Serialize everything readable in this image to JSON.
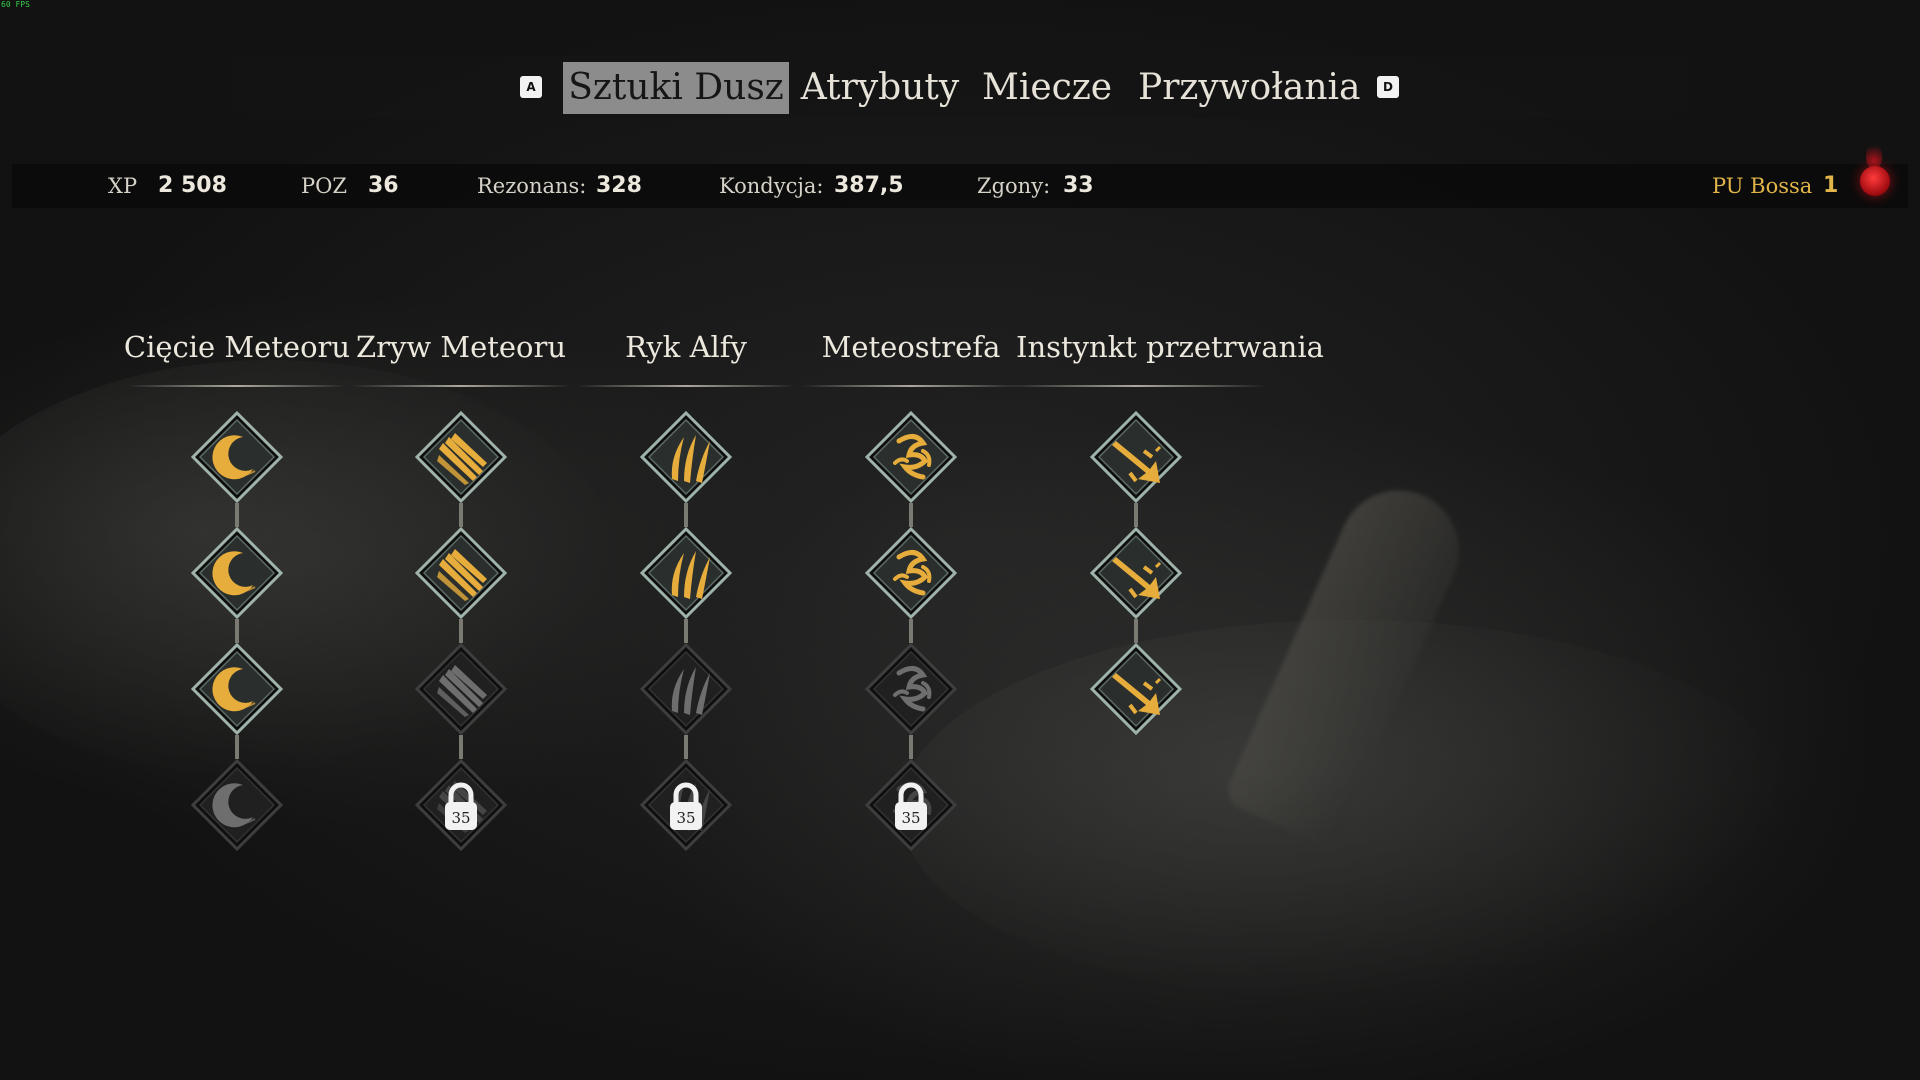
{
  "fps": "60 FPS",
  "tabs": {
    "prev_key": "A",
    "next_key": "D",
    "items": [
      {
        "label": "Sztuki Dusz",
        "active": true
      },
      {
        "label": "Atrybuty",
        "active": false
      },
      {
        "label": "Miecze",
        "active": false
      },
      {
        "label": "Przywołania",
        "active": false
      }
    ]
  },
  "stats": {
    "xp_label": "XP",
    "xp_value": "2 508",
    "level_label": "POZ",
    "level_value": "36",
    "resonance_label": "Rezonans:",
    "resonance_value": "328",
    "condition_label": "Kondycja:",
    "condition_value": "387,5",
    "deaths_label": "Zgony:",
    "deaths_value": "33",
    "boss_label": "PU Bossa",
    "boss_value": "1"
  },
  "colors": {
    "gold": "#e2b54a",
    "node_gold": "#e6ad3c",
    "node_dim": "#6e6e6e",
    "frame_teal": "#9fb3ab"
  },
  "columns": [
    {
      "title": "Cięcie Meteoru",
      "icon": "crescent-moon-icon",
      "nodes": [
        {
          "state": "unlocked"
        },
        {
          "state": "unlocked"
        },
        {
          "state": "unlocked"
        },
        {
          "state": "available"
        }
      ]
    },
    {
      "title": "Zryw Meteoru",
      "icon": "claw-slash-icon",
      "nodes": [
        {
          "state": "unlocked"
        },
        {
          "state": "unlocked"
        },
        {
          "state": "available"
        },
        {
          "state": "locked",
          "level": "35"
        }
      ]
    },
    {
      "title": "Ryk Alfy",
      "icon": "triple-claw-icon",
      "nodes": [
        {
          "state": "unlocked"
        },
        {
          "state": "unlocked"
        },
        {
          "state": "available"
        },
        {
          "state": "locked",
          "level": "35"
        }
      ]
    },
    {
      "title": "Meteostrefa",
      "icon": "rune-glyph-icon",
      "nodes": [
        {
          "state": "unlocked"
        },
        {
          "state": "unlocked"
        },
        {
          "state": "available"
        },
        {
          "state": "locked",
          "level": "35"
        }
      ]
    },
    {
      "title": "Instynkt przetrwania",
      "icon": "impact-strike-icon",
      "nodes": [
        {
          "state": "unlocked"
        },
        {
          "state": "unlocked"
        },
        {
          "state": "unlocked"
        }
      ]
    }
  ]
}
